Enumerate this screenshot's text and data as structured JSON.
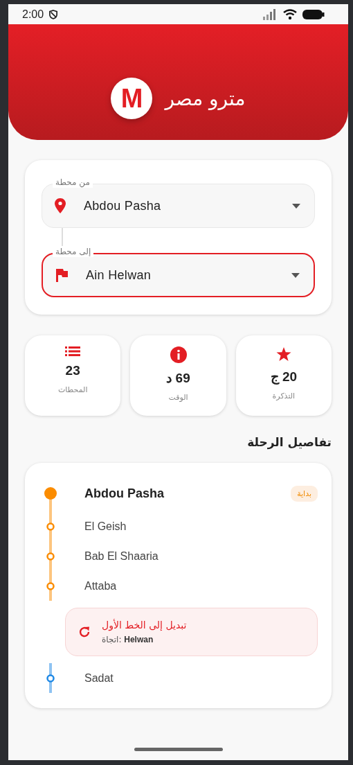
{
  "status_bar": {
    "time": "2:00"
  },
  "header": {
    "title": "مترو مصر",
    "logo_letter": "M"
  },
  "route_form": {
    "from": {
      "label": "من محطة",
      "value": "Abdou Pasha",
      "focused": false
    },
    "to": {
      "label": "إلى محطة",
      "value": "Ain Helwan",
      "focused": true
    }
  },
  "stats": [
    {
      "kind": "price",
      "value": "20 ج",
      "label": "التذكرة"
    },
    {
      "kind": "time",
      "value": "69 د",
      "label": "الوقت"
    },
    {
      "kind": "stations",
      "value": "23",
      "label": "المحطات"
    }
  ],
  "trip_details": {
    "title": "تفاصيل الرحلة",
    "items": [
      {
        "kind": "start",
        "name": "Abdou Pasha",
        "badge": "بداية",
        "color": "#fb8c00"
      },
      {
        "kind": "stop",
        "name": "El Geish",
        "color": "#fb8c00"
      },
      {
        "kind": "stop",
        "name": "Bab El Shaaria",
        "color": "#fb8c00"
      },
      {
        "kind": "stop",
        "name": "Attaba",
        "color": "#fb8c00"
      },
      {
        "kind": "transfer",
        "title": "تبديل إلى الخط الأول",
        "direction_label": "اتجاة:",
        "direction": "Helwan"
      },
      {
        "kind": "stop",
        "name": "Sadat",
        "color": "#1e88e5"
      }
    ]
  }
}
